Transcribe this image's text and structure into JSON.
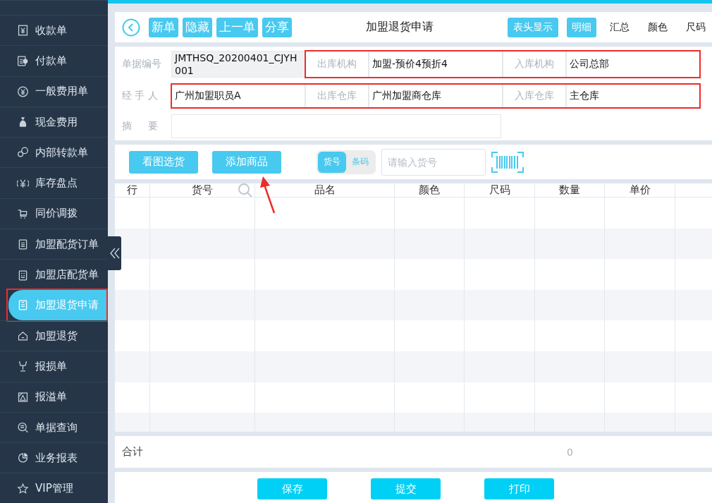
{
  "sidebar": {
    "items": [
      {
        "label": "收款单",
        "selected": false
      },
      {
        "label": "付款单",
        "selected": false
      },
      {
        "label": "一般费用单",
        "selected": false
      },
      {
        "label": "现金费用",
        "selected": false
      },
      {
        "label": "内部转款单",
        "selected": false
      },
      {
        "label": "库存盘点",
        "selected": false
      },
      {
        "label": "同价调拨",
        "selected": false
      },
      {
        "label": "加盟配货订单",
        "selected": false
      },
      {
        "label": "加盟店配货单",
        "selected": false
      },
      {
        "label": "加盟退货申请",
        "selected": true,
        "annotated": true
      },
      {
        "label": "加盟退货",
        "selected": false
      },
      {
        "label": "报损单",
        "selected": false
      },
      {
        "label": "报溢单",
        "selected": false
      },
      {
        "label": "单据查询",
        "selected": false
      },
      {
        "label": "业务报表",
        "selected": false
      },
      {
        "label": "VIP管理",
        "selected": false
      }
    ]
  },
  "toolbar": {
    "buttons": [
      "新单",
      "隐藏",
      "上一单",
      "分享"
    ],
    "title": "加盟退货申请",
    "header_button": "表头显示",
    "view_tabs": [
      {
        "label": "明细",
        "selected": true
      },
      {
        "label": "汇总",
        "selected": false
      },
      {
        "label": "颜色",
        "selected": false
      },
      {
        "label": "尺码",
        "selected": false
      }
    ]
  },
  "form": {
    "rows": [
      {
        "label": "单据编号",
        "cells": [
          {
            "kind": "readonly",
            "value": "JMTHSQ_20200401_CJYH001"
          },
          {
            "kind": "label",
            "label": "出库机构",
            "annotated": true
          },
          {
            "kind": "value",
            "value": "加盟-预价4预折4",
            "annotated": true
          },
          {
            "kind": "label",
            "label": "入库机构",
            "annotated": true
          },
          {
            "kind": "value",
            "value": "公司总部",
            "annotated": true
          }
        ]
      },
      {
        "label": "经 手 人",
        "cells": [
          {
            "kind": "value",
            "value": "广州加盟职员A",
            "annotated": true
          },
          {
            "kind": "label",
            "label": "出库仓库",
            "annotated": true
          },
          {
            "kind": "value",
            "value": "广州加盟商仓库",
            "annotated": true
          },
          {
            "kind": "label",
            "label": "入库仓库",
            "annotated": true
          },
          {
            "kind": "value",
            "value": "主仓库",
            "annotated": true
          }
        ]
      },
      {
        "label": "摘 　 要",
        "cells": [
          {
            "kind": "wide"
          }
        ]
      }
    ]
  },
  "actions": {
    "buttons": [
      {
        "label": "看图选货"
      },
      {
        "label": "添加商品",
        "arrow": true
      }
    ],
    "mode": [
      {
        "label": "货号",
        "selected": true
      },
      {
        "label": "条码",
        "selected": false
      }
    ],
    "search": {
      "placeholder": "请输入货号"
    }
  },
  "table": {
    "columns": [
      "行",
      "货号",
      "品名",
      "颜色",
      "尺码",
      "数量",
      "单价"
    ]
  },
  "total": {
    "label": "合计",
    "quantity": "0"
  },
  "footer": {
    "buttons": [
      "保存",
      "提交",
      "打印"
    ]
  }
}
